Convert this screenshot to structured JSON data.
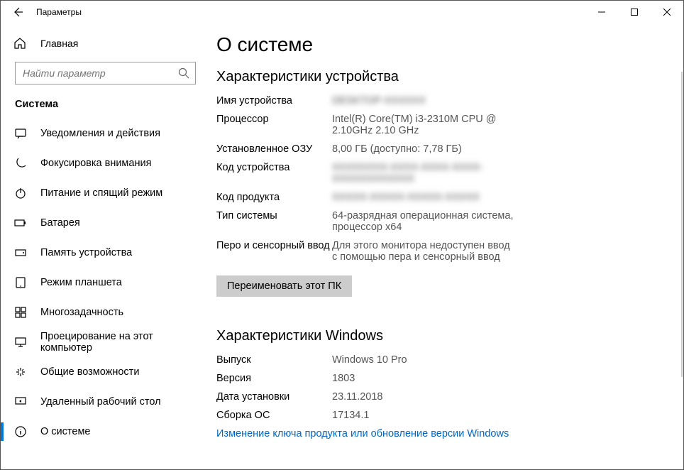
{
  "titlebar": {
    "app_title": "Параметры"
  },
  "sidebar": {
    "home_label": "Главная",
    "search_placeholder": "Найти параметр",
    "section_title": "Система",
    "items": [
      {
        "label": "Уведомления и действия"
      },
      {
        "label": "Фокусировка внимания"
      },
      {
        "label": "Питание и спящий режим"
      },
      {
        "label": "Батарея"
      },
      {
        "label": "Память устройства"
      },
      {
        "label": "Режим планшета"
      },
      {
        "label": "Многозадачность"
      },
      {
        "label": "Проецирование на этот компьютер"
      },
      {
        "label": "Общие возможности"
      },
      {
        "label": "Удаленный рабочий стол"
      },
      {
        "label": "О системе"
      }
    ]
  },
  "content": {
    "page_title": "О системе",
    "device_section": {
      "heading": "Характеристики устройства",
      "rows": {
        "device_name_k": "Имя устройства",
        "device_name_v": "DESKTOP-XXXXXX",
        "processor_k": "Процессор",
        "processor_v": "Intel(R) Core(TM) i3-2310M CPU @ 2.10GHz   2.10 GHz",
        "ram_k": "Установленное ОЗУ",
        "ram_v": "8,00 ГБ (доступно: 7,78 ГБ)",
        "device_id_k": "Код устройства",
        "device_id_v": "XXXXXXXX-XXXX-XXXX-XXXX-XXXXXXXXXXXX",
        "product_id_k": "Код продукта",
        "product_id_v": "XXXXX-XXXXX-XXXXX-XXXXX",
        "system_type_k": "Тип системы",
        "system_type_v": "64-разрядная операционная система, процессор x64",
        "pen_touch_k": "Перо и сенсорный ввод",
        "pen_touch_v": "Для этого монитора недоступен ввод с помощью пера и сенсорный ввод"
      },
      "rename_btn": "Переименовать этот ПК"
    },
    "windows_section": {
      "heading": "Характеристики Windows",
      "rows": {
        "edition_k": "Выпуск",
        "edition_v": "Windows 10 Pro",
        "version_k": "Версия",
        "version_v": "1803",
        "install_date_k": "Дата установки",
        "install_date_v": "23.11.2018",
        "build_k": "Сборка ОС",
        "build_v": "17134.1"
      },
      "change_key_link": "Изменение ключа продукта или обновление версии Windows"
    }
  }
}
